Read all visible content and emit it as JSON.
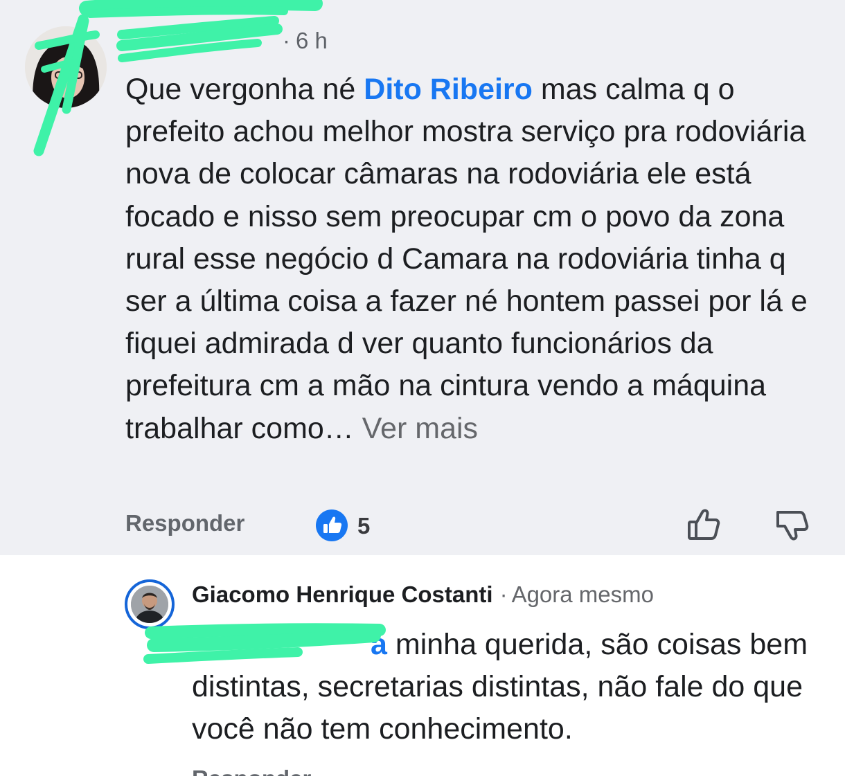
{
  "top_comment": {
    "time": "6 h",
    "body_before_mention": "Que vergonha né ",
    "mention": "Dito Ribeiro",
    "body_after_mention": "  mas calma q o prefeito achou melhor mostra serviço pra rodoviária nova de colocar câmaras na rodoviária ele está focado e nisso sem preocupar cm o povo da zona rural esse negócio d Camara na rodoviária tinha q ser a última coisa a fazer né hontem passei por lá e fiquei admirada d ver quanto funcionários da prefeitura cm a mão na cintura vendo a máquina trabalhar como…",
    "see_more": "Ver mais",
    "reply_label": "Responder",
    "like_count": "5",
    "icons": {
      "avatar": "user-avatar",
      "like_badge": "like-reaction-icon",
      "like_button": "thumbs-up-icon",
      "dislike_button": "thumbs-down-icon"
    }
  },
  "reply": {
    "author": "Giacomo Henrique Costanti",
    "separator": "·",
    "time": "Agora mesmo",
    "mention_fragment": "a",
    "body_after_mention": " minha querida, são coisas bem distintas, secretarias distintas, não fale do que você não tem conhecimento.",
    "next_reply_label": "Responder"
  },
  "colors": {
    "highlight_bg": "#eff0f4",
    "mention": "#1877f2",
    "redaction": "#3ff2a8"
  }
}
